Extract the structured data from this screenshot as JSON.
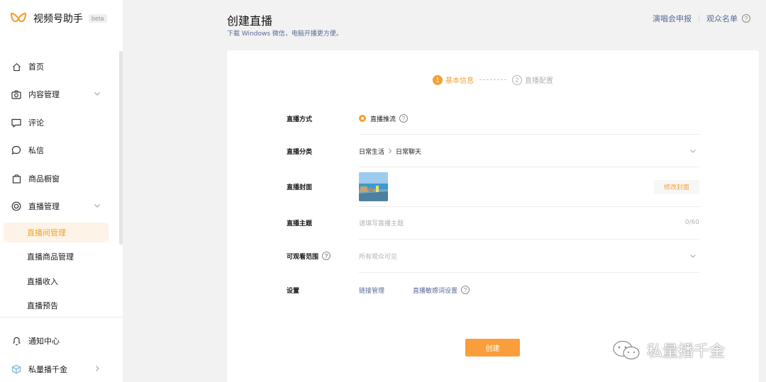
{
  "brand": {
    "name": "视频号助手",
    "badge": "beta",
    "accent": "#f5a031"
  },
  "sidebar": {
    "items": [
      {
        "label": "首页",
        "icon": "home-icon"
      },
      {
        "label": "内容管理",
        "icon": "camera-icon",
        "expandable": true
      },
      {
        "label": "评论",
        "icon": "comment-icon"
      },
      {
        "label": "私信",
        "icon": "message-icon"
      },
      {
        "label": "商品橱窗",
        "icon": "shopping-bag-icon"
      },
      {
        "label": "直播管理",
        "icon": "live-icon",
        "expandable": true
      }
    ],
    "live_sub_items": [
      {
        "label": "直播间管理",
        "active": true
      },
      {
        "label": "直播商品管理"
      },
      {
        "label": "直播收入"
      },
      {
        "label": "直播预告"
      }
    ],
    "bottom_items": [
      {
        "label": "通知中心",
        "icon": "bell-icon"
      },
      {
        "label": "私量播千金",
        "icon": "cube-icon"
      }
    ]
  },
  "header": {
    "title": "创建直播",
    "subtitle": "下载 Windows 微信，电脑开播更方便。",
    "links": [
      "演唱会申报",
      "观众名单"
    ]
  },
  "steps": [
    {
      "num": "1",
      "label": "基本信息",
      "active": true
    },
    {
      "num": "2",
      "label": "直播配置",
      "active": false
    }
  ],
  "form": {
    "mode": {
      "label": "直播方式",
      "value": "直播推流"
    },
    "category": {
      "label": "直播分类",
      "value_main": "日常生活",
      "value_sub": "日常聊天"
    },
    "cover": {
      "label": "直播封面",
      "button": "修改封面"
    },
    "topic": {
      "label": "直播主题",
      "placeholder": "请填写直播主题",
      "counter": "0/60"
    },
    "visibility": {
      "label": "可观看范围",
      "value": "所有观众可见"
    },
    "settings": {
      "label": "设置",
      "links": [
        "链接管理",
        "直播敏感词设置"
      ]
    }
  },
  "create_button": "创建",
  "watermark": "私量播千金"
}
